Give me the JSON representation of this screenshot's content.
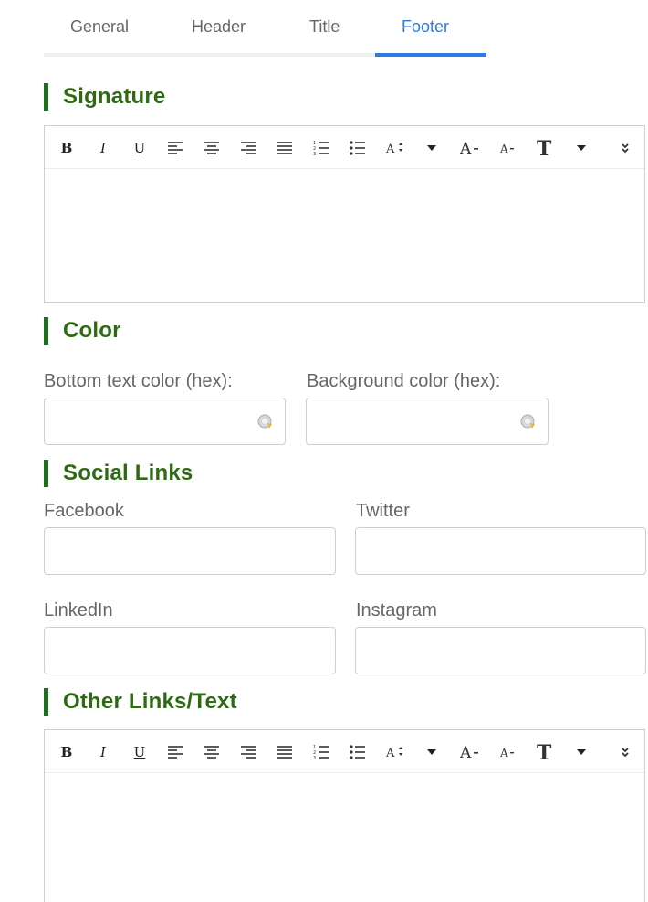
{
  "tabs": [
    {
      "label": "General"
    },
    {
      "label": "Header"
    },
    {
      "label": "Title"
    },
    {
      "label": "Footer"
    }
  ],
  "active_tab": "Footer",
  "sections": {
    "signature": {
      "title": "Signature"
    },
    "color": {
      "title": "Color",
      "bottom_text_label": "Bottom text color (hex):",
      "bottom_text_value": "",
      "background_label": "Background color (hex):",
      "background_value": ""
    },
    "social": {
      "title": "Social Links",
      "facebook_label": "Facebook",
      "twitter_label": "Twitter",
      "linkedin_label": "LinkedIn",
      "instagram_label": "Instagram",
      "facebook_value": "",
      "twitter_value": "",
      "linkedin_value": "",
      "instagram_value": ""
    },
    "other": {
      "title": "Other Links/Text"
    }
  },
  "toolbar": {
    "bold": "B",
    "italic": "I",
    "underline": "U"
  },
  "colors": {
    "accent": "#2b7be0",
    "section_title": "#2e6a14",
    "section_bar": "#1f6b1f"
  }
}
